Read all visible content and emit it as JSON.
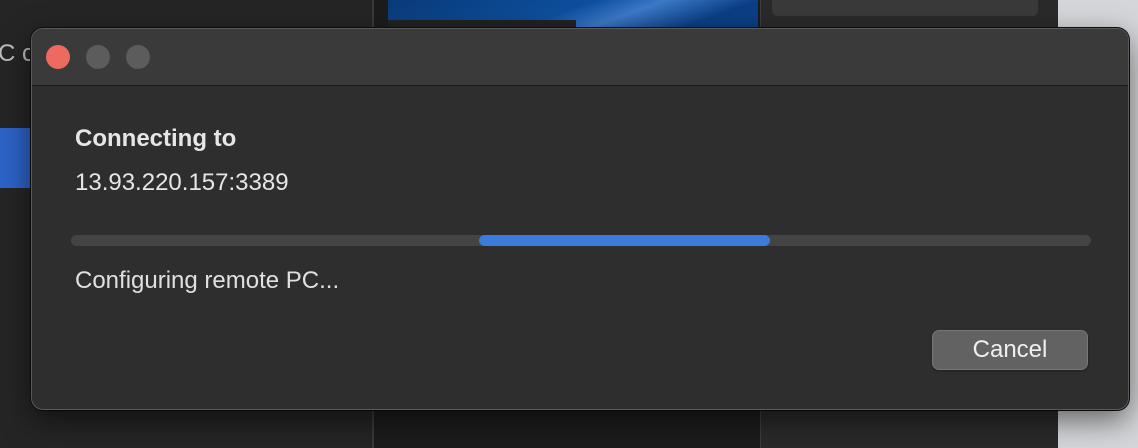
{
  "background": {
    "left_panel_text": "C c"
  },
  "dialog": {
    "heading": "Connecting to",
    "address": "13.93.220.157:3389",
    "progress": {
      "type": "indeterminate",
      "fill_start_fraction": 0.4,
      "fill_end_fraction": 0.685,
      "track_color": "#444444",
      "fill_color": "#3a7bdb"
    },
    "status_text": "Configuring remote PC...",
    "cancel_label": "Cancel",
    "window_controls": {
      "close_color": "#ec6a5e",
      "inactive_color": "#5c5c5c"
    }
  }
}
